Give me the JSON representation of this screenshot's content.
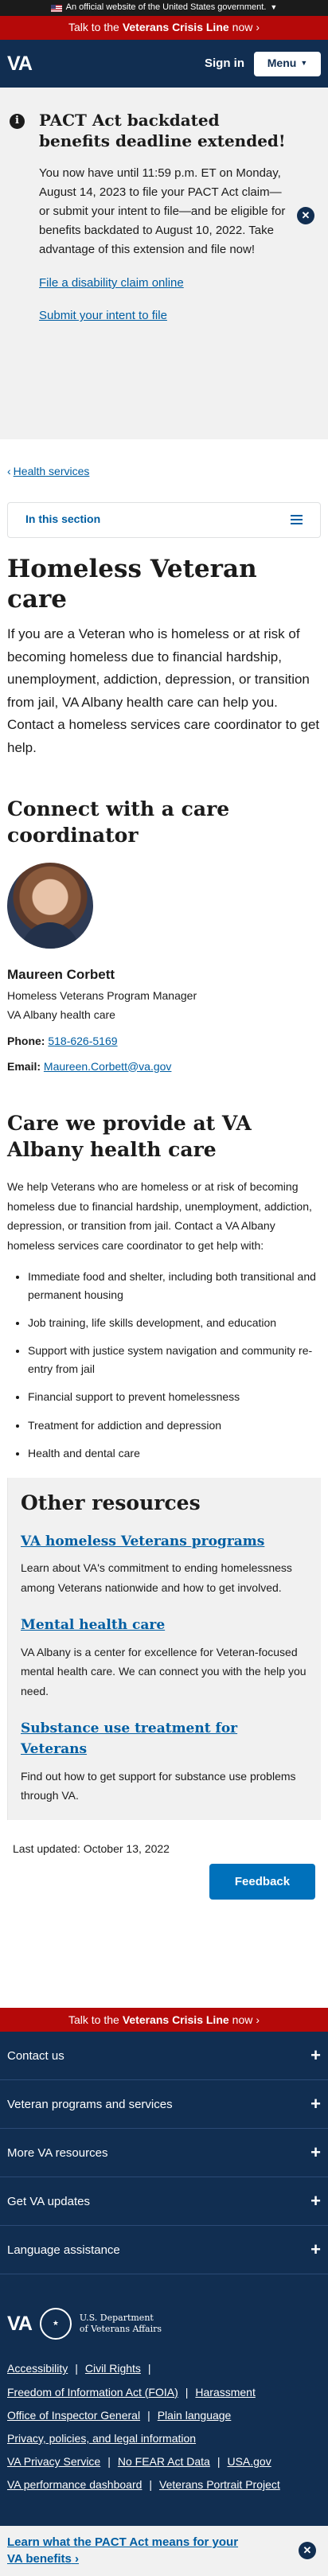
{
  "gov_banner": {
    "text": "An official website of the United States government.",
    "chevron": "chevron-down-icon"
  },
  "crisis": {
    "prefix": "Talk to the",
    "emphasis": "Veterans Crisis Line",
    "suffix": "now",
    "arrow": "›"
  },
  "header": {
    "logo": "VA",
    "sign_in": "Sign in",
    "menu": "Menu"
  },
  "alert": {
    "icon": "info-icon",
    "title": "PACT Act backdated benefits deadline extended!",
    "body": "You now have until 11:59 p.m. ET on Monday, August 14, 2023 to file your PACT Act claim—or submit your intent to file—and be eligible for benefits backdated to August 10, 2022. Take advantage of this extension and file now!",
    "link1": "File a disability claim online",
    "link2": "Submit your intent to file",
    "close_icon": "close-icon"
  },
  "breadcrumb": {
    "arrow": "‹",
    "label": "Health services"
  },
  "section_nav": {
    "label": "In this section"
  },
  "main": {
    "title": "Homeless Veteran care",
    "intro": "If you are a Veteran who is homeless or at risk of becoming homeless due to financial hardship, unemployment, addiction, depression, or transition from jail, VA Albany health care can help you. Contact a homeless services care coordinator to get help.",
    "connect_heading": "Connect with a care coordinator",
    "contact": {
      "name": "Maureen Corbett",
      "role": "Homeless Veterans Program Manager",
      "facility": "VA Albany health care",
      "phone_label": "Phone:",
      "phone": "518-626-5169",
      "email_label": "Email:",
      "email": "Maureen.Corbett@va.gov"
    },
    "care_heading": "Care we provide at VA Albany health care",
    "care_text": "We help Veterans who are homeless or at risk of becoming homeless due to financial hardship, unemployment, addiction, depression, or transition from jail. Contact a VA Albany homeless services care coordinator to get help with:",
    "care_items": [
      "Immediate food and shelter, including both transitional and permanent housing",
      "Job training, life skills development, and education",
      "Support with justice system navigation and community re-entry from jail",
      "Financial support to prevent homelessness",
      "Treatment for addiction and depression",
      "Health and dental care"
    ]
  },
  "resources": {
    "heading": "Other resources",
    "items": [
      {
        "title": "VA homeless Veterans programs",
        "desc": "Learn about VA's commitment to ending homelessness among Veterans nationwide and how to get involved."
      },
      {
        "title": "Mental health care",
        "desc": "VA Albany is a center for excellence for Veteran-focused mental health care. We can connect you with the help you need."
      },
      {
        "title": "Substance use treatment for Veterans",
        "desc": "Find out how to get support for substance use problems through VA."
      }
    ]
  },
  "last_updated": "Last updated: October 13, 2022",
  "feedback": "Feedback",
  "footer": {
    "sections": [
      "Contact us",
      "Veteran programs and services",
      "More VA resources",
      "Get VA updates",
      "Language assistance"
    ],
    "logo": "VA",
    "dept_line1": "U.S. Department",
    "dept_line2": "of Veterans Affairs",
    "links": {
      "accessibility": "Accessibility",
      "civil_rights": "Civil Rights",
      "foia": "Freedom of Information Act (FOIA)",
      "harassment": "Harassment",
      "oig": "Office of Inspector General",
      "plain_language": "Plain language",
      "privacy": "Privacy, policies, and legal information",
      "va_privacy": "VA Privacy Service",
      "no_fear": "No FEAR Act Data",
      "usagov": "USA.gov",
      "dashboard": "VA performance dashboard",
      "portrait": "Veterans Portrait Project"
    }
  },
  "pact_bar": {
    "text": "Learn what the PACT Act means for your VA benefits",
    "arrow": "›"
  },
  "colors": {
    "navy": "#112e51",
    "crisis_red": "#b50909",
    "link_blue": "#005ea2",
    "feedback_blue": "#0071bb",
    "gray_bg": "#f1f1f1"
  }
}
